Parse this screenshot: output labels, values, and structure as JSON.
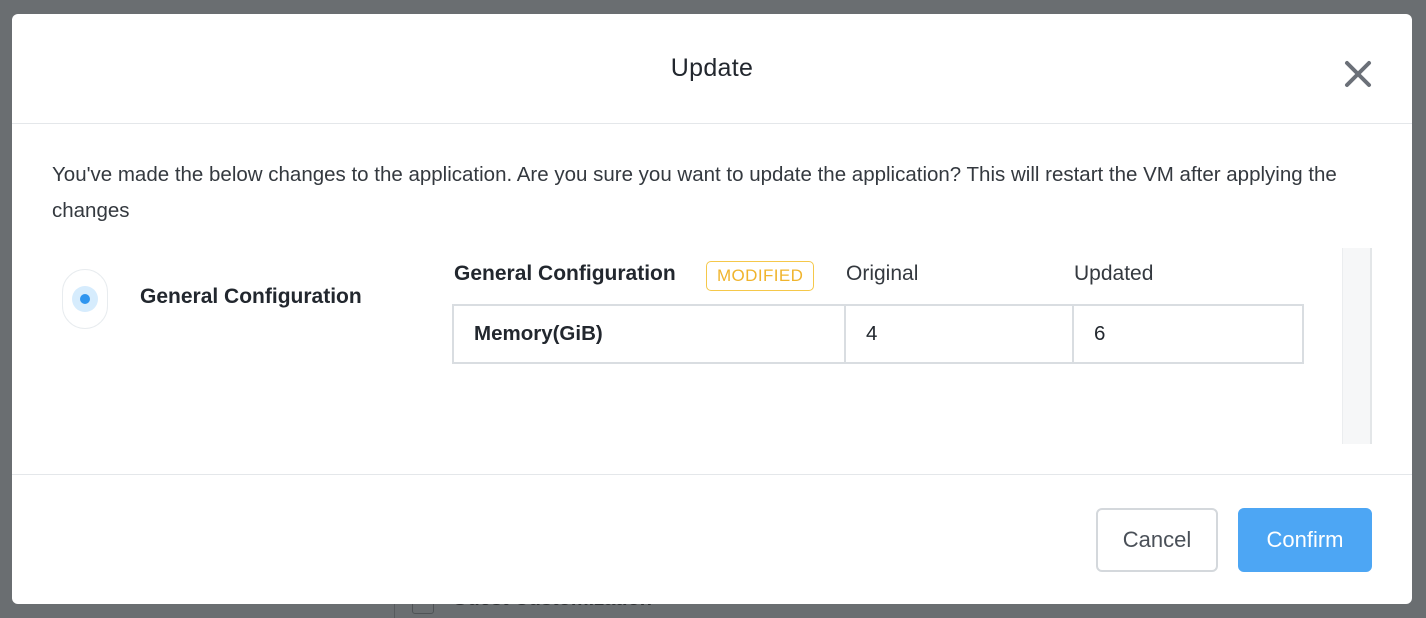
{
  "background": {
    "partial_section_label": "Guest Customization"
  },
  "modal": {
    "title": "Update",
    "close_icon": "close-icon",
    "intro": "You've made the below changes to the application. Are you sure you want to update the application? This will restart the VM after applying the changes",
    "sections": [
      {
        "label": "General Configuration",
        "selected": true
      }
    ],
    "diff": {
      "title": "General Configuration",
      "badge": "MODIFIED",
      "columns": {
        "original": "Original",
        "updated": "Updated"
      },
      "rows": [
        {
          "field": "Memory(GiB)",
          "original": "4",
          "updated": "6"
        }
      ]
    },
    "footer": {
      "cancel_label": "Cancel",
      "confirm_label": "Confirm"
    }
  },
  "colors": {
    "accent": "#4da6f4",
    "badge": "#f0b42d",
    "radio": "#2f95ef"
  }
}
